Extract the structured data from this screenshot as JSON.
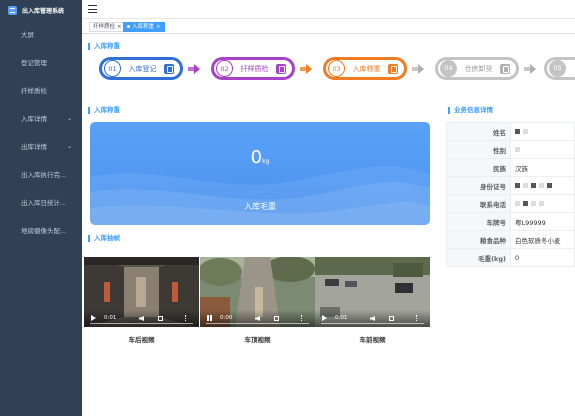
{
  "app": {
    "title": "出入库管理系统"
  },
  "sidebar": {
    "items": [
      {
        "label": "大屏",
        "chevron": ""
      },
      {
        "label": "登记管理",
        "chevron": ""
      },
      {
        "label": "扦样质检",
        "chevron": ""
      },
      {
        "label": "入库详情",
        "chevron": "⌄"
      },
      {
        "label": "出库详情",
        "chevron": "⌄"
      },
      {
        "label": "出入库执行完...",
        "chevron": ""
      },
      {
        "label": "出入库日统计...",
        "chevron": ""
      },
      {
        "label": "地磅摄像头配...",
        "chevron": ""
      }
    ]
  },
  "tags": [
    {
      "label": "扦样质检",
      "close": "×",
      "active": false
    },
    {
      "label": "入库称重",
      "close": "×",
      "active": true
    }
  ],
  "steps_section": {
    "title": "入库称重"
  },
  "steps": [
    {
      "num": "01",
      "label": "入库登记",
      "color": "#2f6fd6"
    },
    {
      "num": "02",
      "label": "扦样质检",
      "color": "#a741c9"
    },
    {
      "num": "03",
      "label": "入库称重",
      "color": "#f07d24"
    },
    {
      "num": "04",
      "label": "仓房卸货",
      "color": "#b0b0b0"
    },
    {
      "num": "05",
      "label": "",
      "color": "#b0b0b0"
    }
  ],
  "weigh": {
    "section_title": "入库称重",
    "value": "0",
    "unit": "kg",
    "label": "入库毛重"
  },
  "video_section": {
    "title": "入库抽帧"
  },
  "videos": [
    {
      "caption": "车后视频",
      "time": "0:01",
      "state": "play"
    },
    {
      "caption": "车顶视频",
      "time": "0:00",
      "state": "pause"
    },
    {
      "caption": "车前视频",
      "time": "0:01",
      "state": "play"
    }
  ],
  "info": {
    "title": "业务信息详情",
    "rows": [
      {
        "key": "姓名",
        "value": ""
      },
      {
        "key": "性别",
        "value": ""
      },
      {
        "key": "民族",
        "value": "汉族"
      },
      {
        "key": "身份证号",
        "value": ""
      },
      {
        "key": "联系电话",
        "value": ""
      },
      {
        "key": "车牌号",
        "value": "粤L99999"
      },
      {
        "key": "粮食品种",
        "value": "白色软质冬小麦"
      },
      {
        "key": "毛重(kg)",
        "value": "0"
      }
    ]
  }
}
